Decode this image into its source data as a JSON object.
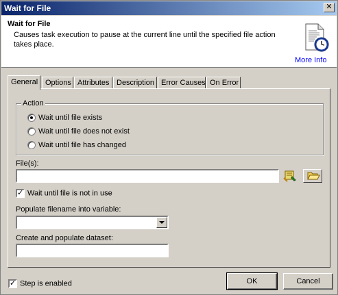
{
  "window": {
    "title": "Wait for File",
    "close_glyph": "✕"
  },
  "header": {
    "title": "Wait for File",
    "description": "Causes task execution to pause at the current line until the specified file action takes place.",
    "more_info": "More Info",
    "icon": "document-clock-icon"
  },
  "tabs": [
    {
      "label": "General",
      "active": true
    },
    {
      "label": "Options"
    },
    {
      "label": "Attributes"
    },
    {
      "label": "Description"
    },
    {
      "label": "Error Causes"
    },
    {
      "label": "On Error"
    }
  ],
  "action": {
    "legend": "Action",
    "options": [
      {
        "label": "Wait until file exists",
        "checked": true
      },
      {
        "label": "Wait until file does not exist",
        "checked": false
      },
      {
        "label": "Wait until file has changed",
        "checked": false
      }
    ]
  },
  "files": {
    "label": "File(s):",
    "value": ""
  },
  "wait_in_use": {
    "label": "Wait until file is not in use",
    "checked": true,
    "glyph": "✓"
  },
  "populate_filename": {
    "label": "Populate filename into variable:",
    "value": ""
  },
  "populate_dataset": {
    "label": "Create and populate dataset:",
    "value": ""
  },
  "footer": {
    "step_enabled": {
      "label": "Step is enabled",
      "checked": true,
      "glyph": "✓"
    },
    "ok": "OK",
    "cancel": "Cancel"
  },
  "colors": {
    "titlebar_start": "#0a246a",
    "titlebar_end": "#a6caf0",
    "dialog_bg": "#d4d0c8",
    "link": "#0000ff"
  }
}
